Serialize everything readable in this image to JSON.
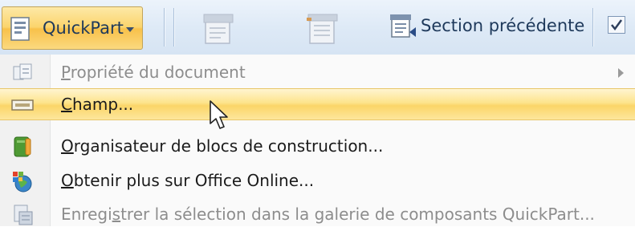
{
  "ribbon": {
    "quickpart_label": "QuickPart",
    "section_prev_label": "Section précédente",
    "icons": [
      "quickpart-icon",
      "dropdown-arrow-icon",
      "header-icon",
      "footer-icon",
      "section-previous-icon",
      "checkbox-icon"
    ]
  },
  "menu": {
    "items": [
      {
        "accel": "P",
        "rest": "ropriété du document",
        "icon": "document-property-icon",
        "disabled": true,
        "submenu": true
      },
      {
        "accel": "C",
        "rest": "hamp...",
        "icon": "field-icon",
        "highlighted": true
      },
      {
        "accel": "O",
        "rest": "rganisateur de blocs de construction...",
        "icon": "building-blocks-icon"
      },
      {
        "accel": "O",
        "rest": "btenir plus sur Office Online...",
        "icon": "office-online-icon"
      },
      {
        "before": "Enregi",
        "accel": "s",
        "rest": "trer la sélection dans la galerie de composants QuickPart...",
        "icon": "save-selection-icon",
        "disabled": true
      }
    ]
  },
  "colors": {
    "highlight": "#fbd568",
    "ribbon_bg": "#dde9f6",
    "text": "#1b1b1b",
    "disabled_text": "#8d8d8d"
  }
}
